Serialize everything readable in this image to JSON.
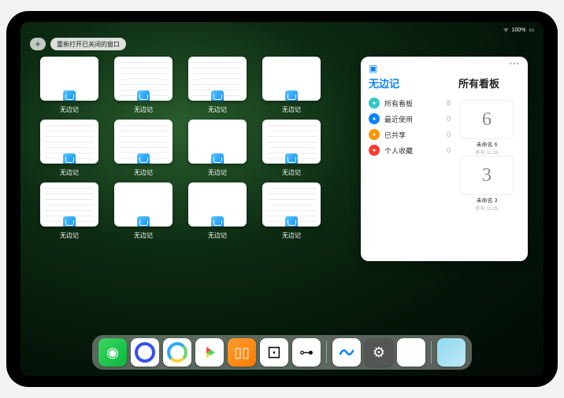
{
  "status": {
    "time": "",
    "battery": "100%",
    "wifi": "⋮⋮"
  },
  "topbar": {
    "plus": "+",
    "reopen": "重新打开已关闭的窗口"
  },
  "thumbs": [
    {
      "label": "无边记",
      "detail": false
    },
    {
      "label": "无边记",
      "detail": true
    },
    {
      "label": "无边记",
      "detail": true
    },
    {
      "label": "无边记",
      "detail": false
    },
    {
      "label": "无边记",
      "detail": true
    },
    {
      "label": "无边记",
      "detail": true
    },
    {
      "label": "无边记",
      "detail": false
    },
    {
      "label": "无边记",
      "detail": true
    },
    {
      "label": "无边记",
      "detail": true
    },
    {
      "label": "无边记",
      "detail": false
    },
    {
      "label": "无边记",
      "detail": false
    },
    {
      "label": "无边记",
      "detail": true
    }
  ],
  "panel": {
    "left_title": "无边记",
    "right_title": "所有看板",
    "items": [
      {
        "icon": "square-icon",
        "color": "#34c8c8",
        "label": "所有看板",
        "count": "8"
      },
      {
        "icon": "clock-icon",
        "color": "#0a84ff",
        "label": "最近使用",
        "count": "0"
      },
      {
        "icon": "person-icon",
        "color": "#ff9500",
        "label": "已共享",
        "count": "0"
      },
      {
        "icon": "heart-icon",
        "color": "#ff3b30",
        "label": "个人收藏",
        "count": "0"
      }
    ],
    "boards": [
      {
        "glyph": "6",
        "name": "未命名 6",
        "date": "昨天 11:28"
      },
      {
        "glyph": "3",
        "name": "未命名 3",
        "date": "昨天 11:25"
      }
    ]
  },
  "dock": [
    {
      "name": "wechat-icon",
      "cls": "di-wechat"
    },
    {
      "name": "quark-icon",
      "cls": "di-quark"
    },
    {
      "name": "qq-browser-icon",
      "cls": "di-qqb"
    },
    {
      "name": "play-icon",
      "cls": "di-play"
    },
    {
      "name": "books-icon",
      "cls": "di-books"
    },
    {
      "name": "dice-icon",
      "cls": "di-dice"
    },
    {
      "name": "connect-icon",
      "cls": "di-connect"
    },
    {
      "name": "freeform-icon",
      "cls": "di-freeform"
    },
    {
      "name": "settings-icon",
      "cls": "di-settings"
    },
    {
      "name": "notes-icon",
      "cls": "di-notes"
    },
    {
      "name": "app-library-icon",
      "cls": "di-library"
    }
  ]
}
